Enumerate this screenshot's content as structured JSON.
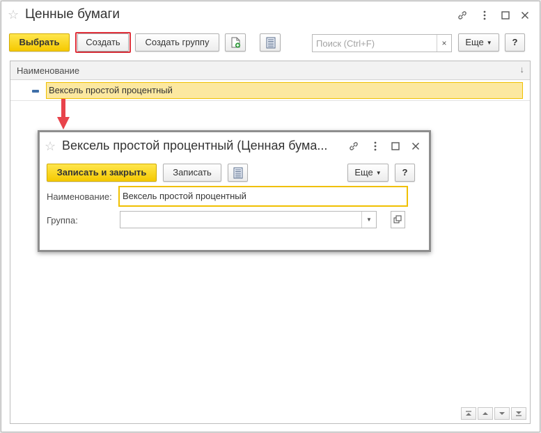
{
  "window": {
    "title": "Ценные бумаги",
    "toolbar": {
      "select_label": "Выбрать",
      "create_label": "Создать",
      "create_group_label": "Создать группу",
      "search_placeholder": "Поиск (Ctrl+F)",
      "search_clear": "×",
      "more_label": "Еще",
      "help_label": "?"
    },
    "list": {
      "column_header": "Наименование",
      "sort_glyph": "↓",
      "rows": [
        {
          "name": "Вексель простой процентный"
        }
      ]
    }
  },
  "dialog": {
    "title": "Вексель простой процентный (Ценная бума...",
    "toolbar": {
      "save_close_label": "Записать и закрыть",
      "save_label": "Записать",
      "more_label": "Еще",
      "help_label": "?"
    },
    "fields": {
      "name_label": "Наименование:",
      "name_value": "Вексель простой процентный",
      "group_label": "Группа:",
      "group_value": ""
    }
  },
  "colors": {
    "accent_yellow": "#f5c900",
    "selected_row": "#fce8a0",
    "highlight_red": "#e0303a",
    "arrow_red": "#e8434b"
  },
  "icons": [
    "star-icon",
    "link-icon",
    "more-vert-icon",
    "maximize-icon",
    "close-icon",
    "add-doc-icon",
    "list-report-icon",
    "dropdown-icon",
    "open-icon",
    "nav-first-icon",
    "nav-up-icon",
    "nav-down-icon",
    "nav-last-icon"
  ]
}
